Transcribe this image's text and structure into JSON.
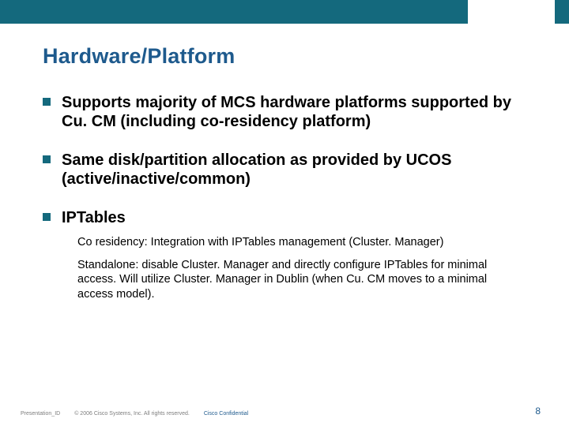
{
  "title": "Hardware/Platform",
  "bullets": [
    {
      "text": "Supports majority of MCS hardware platforms supported by Cu. CM (including co-residency platform)"
    },
    {
      "text": "Same disk/partition allocation as provided by UCOS (active/inactive/common)"
    },
    {
      "text": "IPTables",
      "subs": [
        "Co residency: Integration with IPTables management (Cluster. Manager)",
        "Standalone: disable Cluster. Manager and directly configure IPTables for minimal access.  Will utilize Cluster. Manager in Dublin (when Cu. CM moves to a minimal access model)."
      ]
    }
  ],
  "footer": {
    "presentation_id": "Presentation_ID",
    "copyright": "© 2006 Cisco Systems, Inc. All rights reserved.",
    "confidential": "Cisco Confidential",
    "page_number": "8"
  }
}
